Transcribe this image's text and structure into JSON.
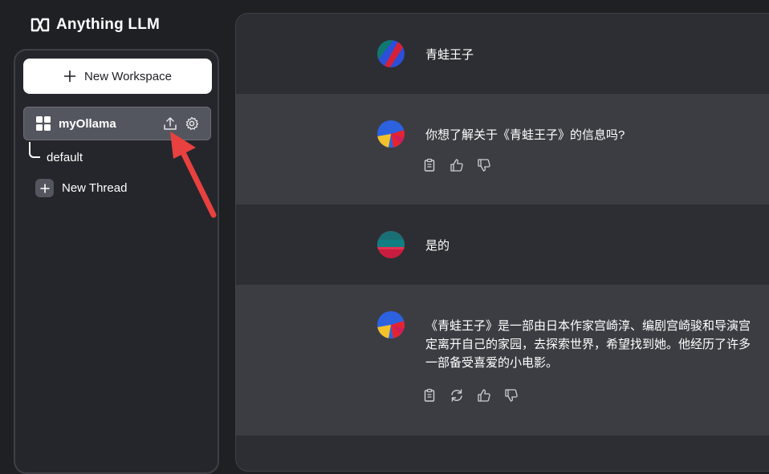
{
  "app": {
    "brand": "Anything LLM",
    "colors": {
      "background": "#1f2024",
      "sidebar": "#25262b",
      "workspace_active": "#53565e",
      "ai_message": "#3c3d43",
      "user_message": "#2d2e33",
      "arrow": "#e8413f"
    }
  },
  "sidebar": {
    "new_workspace_label": "New Workspace",
    "workspace": {
      "name": "myOllama",
      "icon": "grid-icon",
      "actions": [
        "upload-icon",
        "gear-icon"
      ]
    },
    "threads": [
      {
        "name": "default"
      }
    ],
    "new_thread_label": "New Thread"
  },
  "chat": {
    "messages": [
      {
        "role": "user",
        "text": "青蛙王子"
      },
      {
        "role": "assistant",
        "text": "你想了解关于《青蛙王子》的信息吗?",
        "actions": [
          "clipboard-icon",
          "thumbs-up-icon",
          "thumbs-down-icon"
        ]
      },
      {
        "role": "user",
        "text": "是的"
      },
      {
        "role": "assistant",
        "lines": [
          "《青蛙王子》是一部由日本作家宫崎淳、编剧宫崎骏和导演宫",
          "定离开自己的家园，去探索世界，希望找到她。他经历了许多",
          "一部备受喜爱的小电影。"
        ],
        "actions": [
          "clipboard-icon",
          "regenerate-icon",
          "thumbs-up-icon",
          "thumbs-down-icon"
        ]
      }
    ]
  }
}
